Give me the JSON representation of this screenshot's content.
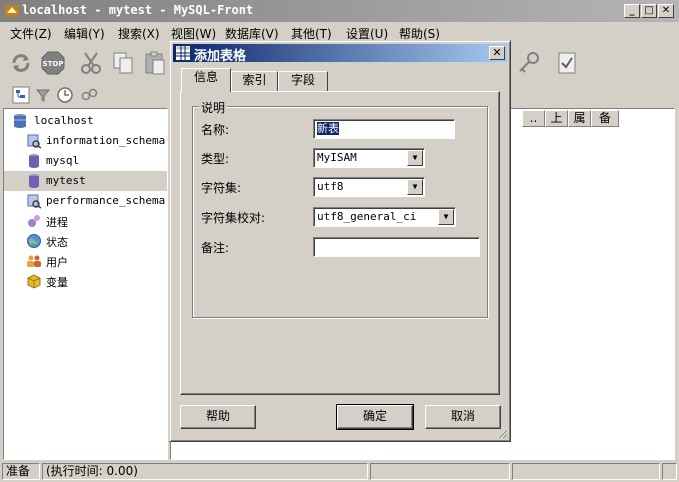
{
  "window": {
    "title": "localhost - mytest - MySQL-Front"
  },
  "menu": [
    "文件(Z)",
    "编辑(Y)",
    "搜索(X)",
    "视图(W)",
    "数据库(V)",
    "其他(T)",
    "设置(U)",
    "帮助(S)"
  ],
  "icons": {
    "toolbar": [
      "refresh-icon",
      "stop-icon",
      "cut-icon",
      "copy-icon",
      "paste-icon",
      "key-icon",
      "checklist-icon"
    ],
    "left_tabs": [
      "tree-view-icon",
      "filter-icon",
      "clock-icon",
      "search-icon"
    ]
  },
  "tree": {
    "root": "localhost",
    "databases": [
      "information_schema",
      "mysql",
      "mytest",
      "performance_schema"
    ],
    "selected": "mytest",
    "others": [
      "进程",
      "状态",
      "用户",
      "变量"
    ]
  },
  "right_pane": {
    "columns": [
      "..",
      "上",
      "属",
      "备"
    ]
  },
  "dialog": {
    "title": "添加表格",
    "tabs": [
      "信息",
      "索引",
      "字段"
    ],
    "active_tab": "信息",
    "group_title": "说明",
    "fields": {
      "name_label": "名称:",
      "name_value": "新表",
      "type_label": "类型:",
      "type_value": "MyISAM",
      "charset_label": "字符集:",
      "charset_value": "utf8",
      "collation_label": "字符集校对:",
      "collation_value": "utf8_general_ci",
      "comment_label": "备注:",
      "comment_value": ""
    },
    "buttons": {
      "help": "帮助",
      "ok": "确定",
      "cancel": "取消"
    }
  },
  "status": {
    "state": "准备",
    "exec_time": "(执行时间: 0.00)"
  }
}
